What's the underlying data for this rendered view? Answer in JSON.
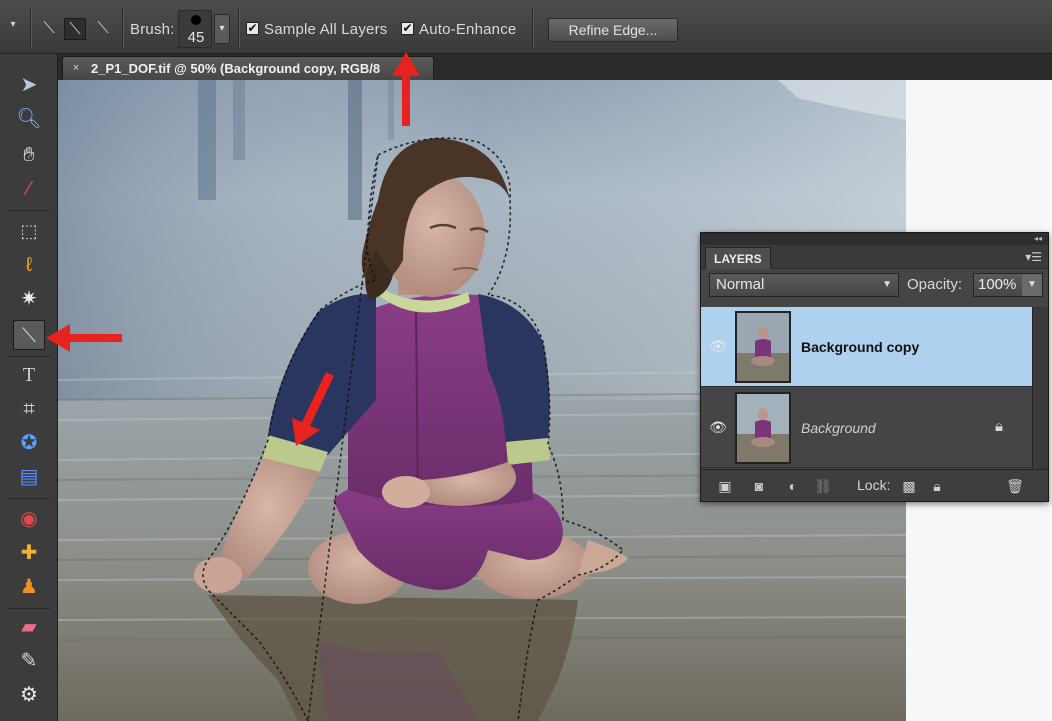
{
  "options_bar": {
    "brush_label": "Brush:",
    "brush_size": "45",
    "sample_all_layers_label": "Sample All Layers",
    "sample_all_layers_checked": true,
    "auto_enhance_label": "Auto-Enhance",
    "auto_enhance_checked": true,
    "refine_edge_label": "Refine Edge..."
  },
  "document_tab": {
    "close_glyph": "×",
    "title": "2_P1_DOF.tif @ 50% (Background copy, RGB/8"
  },
  "toolbox": {
    "tools": [
      "move-tool",
      "zoom-tool",
      "hand-tool",
      "eyedropper-tool",
      "marquee-tool",
      "lasso-tool",
      "magic-wand-tool",
      "quick-selection-tool",
      "type-tool",
      "crop-tool",
      "cookie-cutter-tool",
      "straighten-tool",
      "red-eye-tool",
      "healing-brush-tool",
      "clone-stamp-tool",
      "eraser-tool",
      "brush-tool",
      "smart-brush-tool"
    ],
    "active_tool": "quick-selection-tool"
  },
  "layers_panel": {
    "tab_label": "LAYERS",
    "blend_mode": "Normal",
    "opacity_label": "Opacity:",
    "opacity_value": "100%",
    "lock_label": "Lock:",
    "layers": [
      {
        "name": "Background copy",
        "visible": true,
        "selected": true,
        "locked": false
      },
      {
        "name": "Background",
        "visible": true,
        "selected": false,
        "locked": true
      }
    ],
    "selected_color": "#aed1ef"
  },
  "annotations": {
    "arrow_color": "#e8231e"
  }
}
